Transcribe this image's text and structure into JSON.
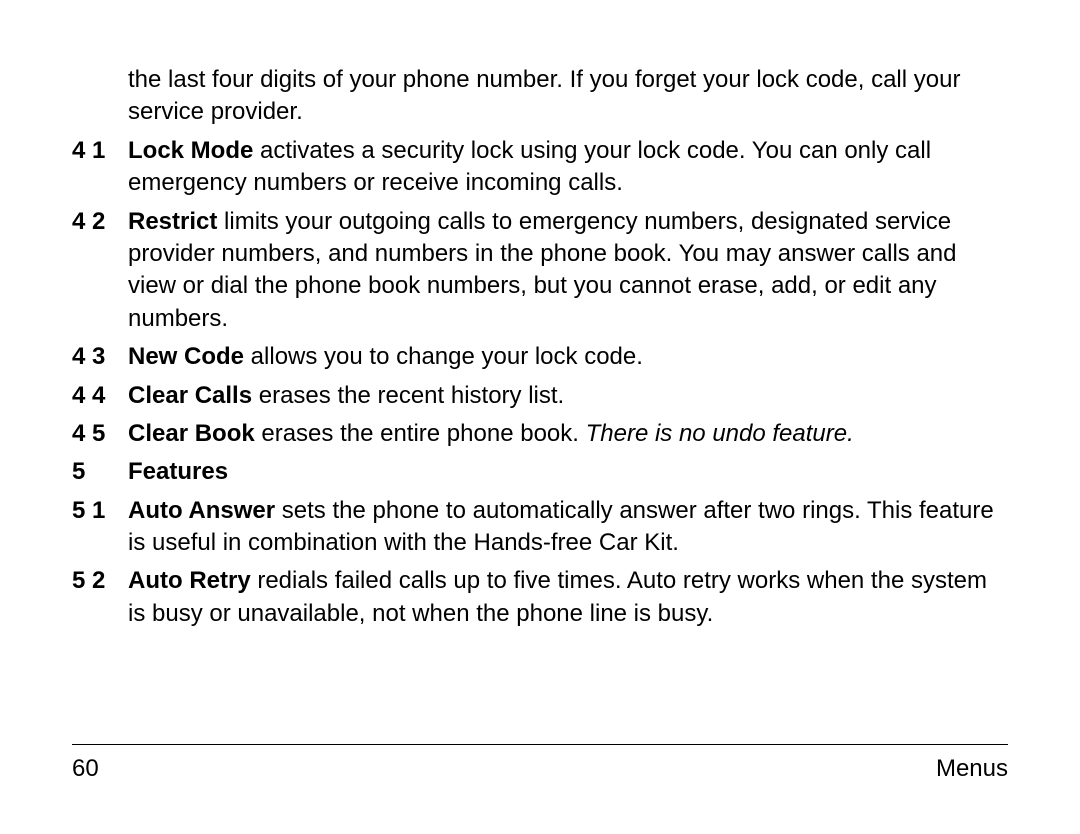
{
  "intro": "the last four digits of your phone number. If you forget your lock code, call your service provider.",
  "items": {
    "lockMode": {
      "num": "4 1",
      "bold": "Lock Mode",
      "text": " activates a security lock using your lock code. You can only call emergency numbers or receive incoming calls."
    },
    "restrict": {
      "num": "4 2",
      "bold": "Restrict",
      "text": " limits your outgoing calls to emergency numbers, designated service provider numbers, and numbers in the phone book. You may answer calls and view or dial the phone book numbers, but you cannot erase, add, or edit any numbers."
    },
    "newCode": {
      "num": "4 3",
      "bold": "New Code",
      "text": " allows you to change your lock code."
    },
    "clearCalls": {
      "num": "4 4",
      "bold": "Clear Calls",
      "text": " erases the recent history list."
    },
    "clearBook": {
      "num": "4 5",
      "bold": "Clear Book",
      "text1": " erases the entire phone book. ",
      "italic": "There is no undo feature."
    },
    "features": {
      "num": "5",
      "bold": "Features"
    },
    "autoAnswer": {
      "num": "5 1",
      "bold": "Auto Answer",
      "text": " sets the phone to automatically answer after two rings. This feature is useful in combination with the Hands-free Car Kit."
    },
    "autoRetry": {
      "num": "5 2",
      "bold": "Auto Retry",
      "text": " redials failed calls up to five times. Auto retry works when the system is busy or unavailable, not when the phone line is busy."
    }
  },
  "footer": {
    "pageNumber": "60",
    "section": "Menus"
  }
}
